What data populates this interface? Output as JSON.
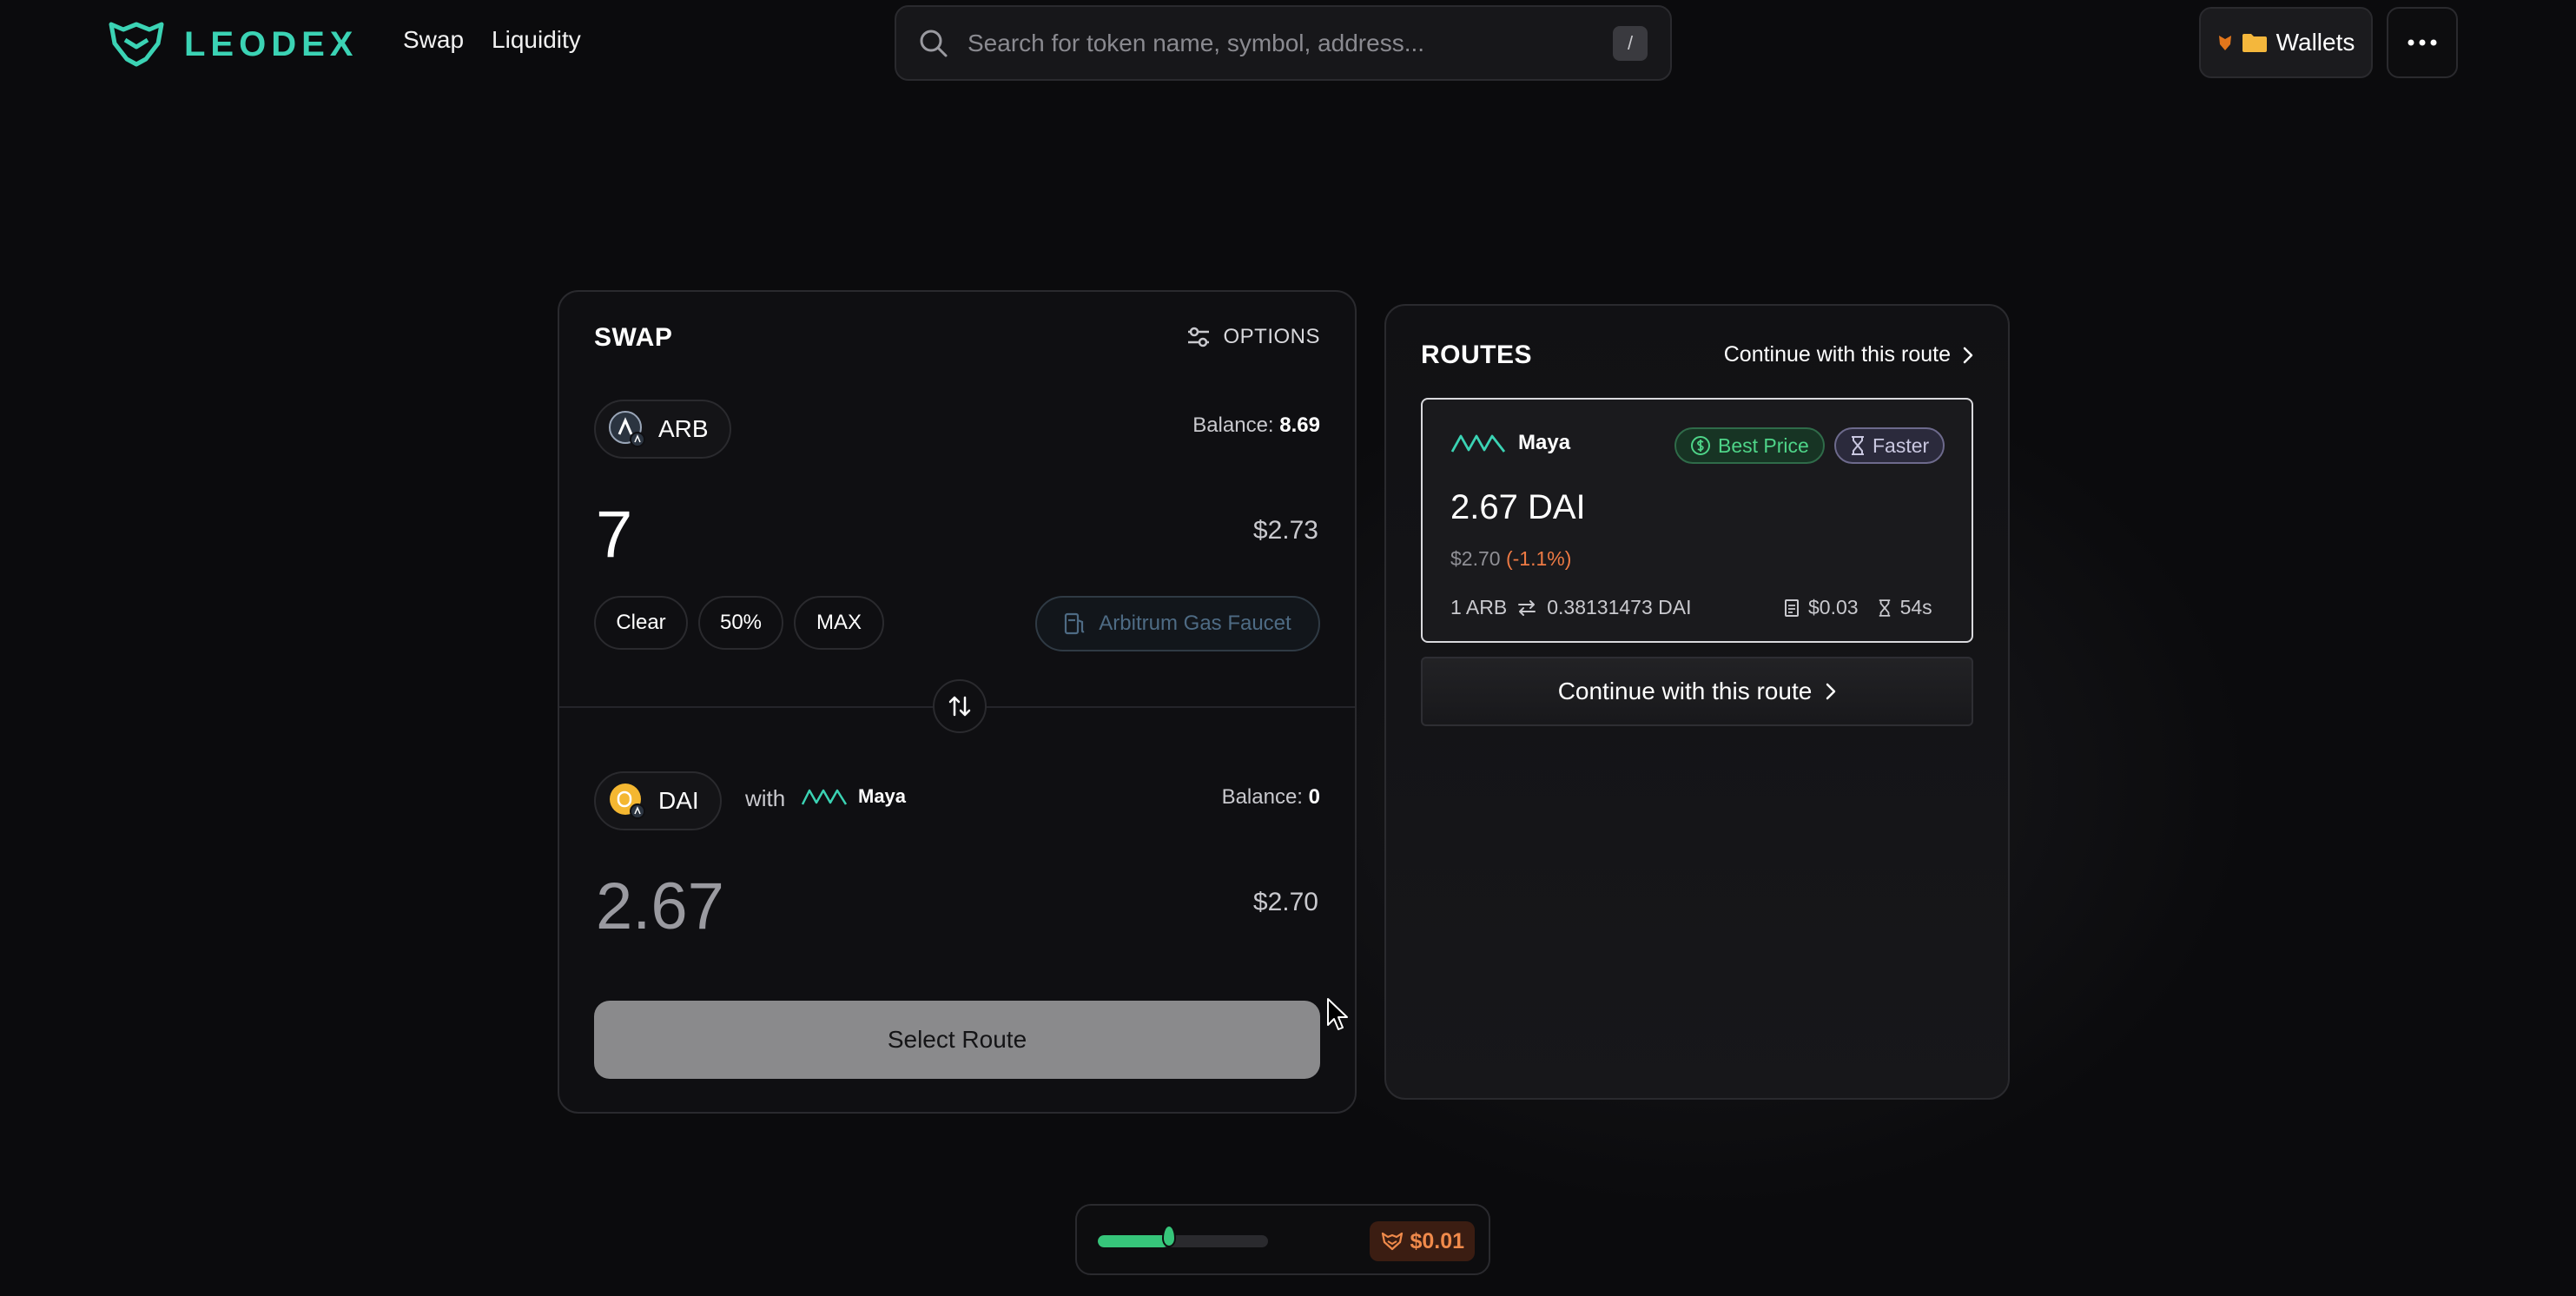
{
  "header": {
    "brand": "LEODEX",
    "nav": [
      "Swap",
      "Liquidity"
    ],
    "search": {
      "placeholder": "Search for token name, symbol, address...",
      "shortcut": "/"
    },
    "wallets_label": "Wallets"
  },
  "swap": {
    "title": "SWAP",
    "options_label": "OPTIONS",
    "from": {
      "token": "ARB",
      "balance_label": "Balance:",
      "balance_value": "8.69",
      "amount": "7",
      "usd": "$2.73",
      "chips": [
        "Clear",
        "50%",
        "MAX"
      ],
      "faucet_label": "Arbitrum Gas Faucet"
    },
    "to": {
      "token": "DAI",
      "with_label": "with",
      "provider": "Maya",
      "balance_label": "Balance:",
      "balance_value": "0",
      "amount": "2.67",
      "usd": "$2.70"
    },
    "select_route_label": "Select Route"
  },
  "routes": {
    "title": "ROUTES",
    "continue_link": "Continue with this route",
    "route": {
      "provider": "Maya",
      "badges": [
        "Best Price",
        "Faster"
      ],
      "amount": "2.67 DAI",
      "usd": "$2.70",
      "change": "(-1.1%)",
      "rate_from": "1 ARB",
      "rate_to": "0.38131473 DAI",
      "fee": "$0.03",
      "time": "54s"
    },
    "continue_button": "Continue with this route"
  },
  "gas": {
    "level": 0.42,
    "price": "$0.01"
  },
  "colors": {
    "brand": "#3bd3b4",
    "positive": "#4ed488",
    "negative": "#ee7a44",
    "gas_fill": "#36c57a"
  }
}
